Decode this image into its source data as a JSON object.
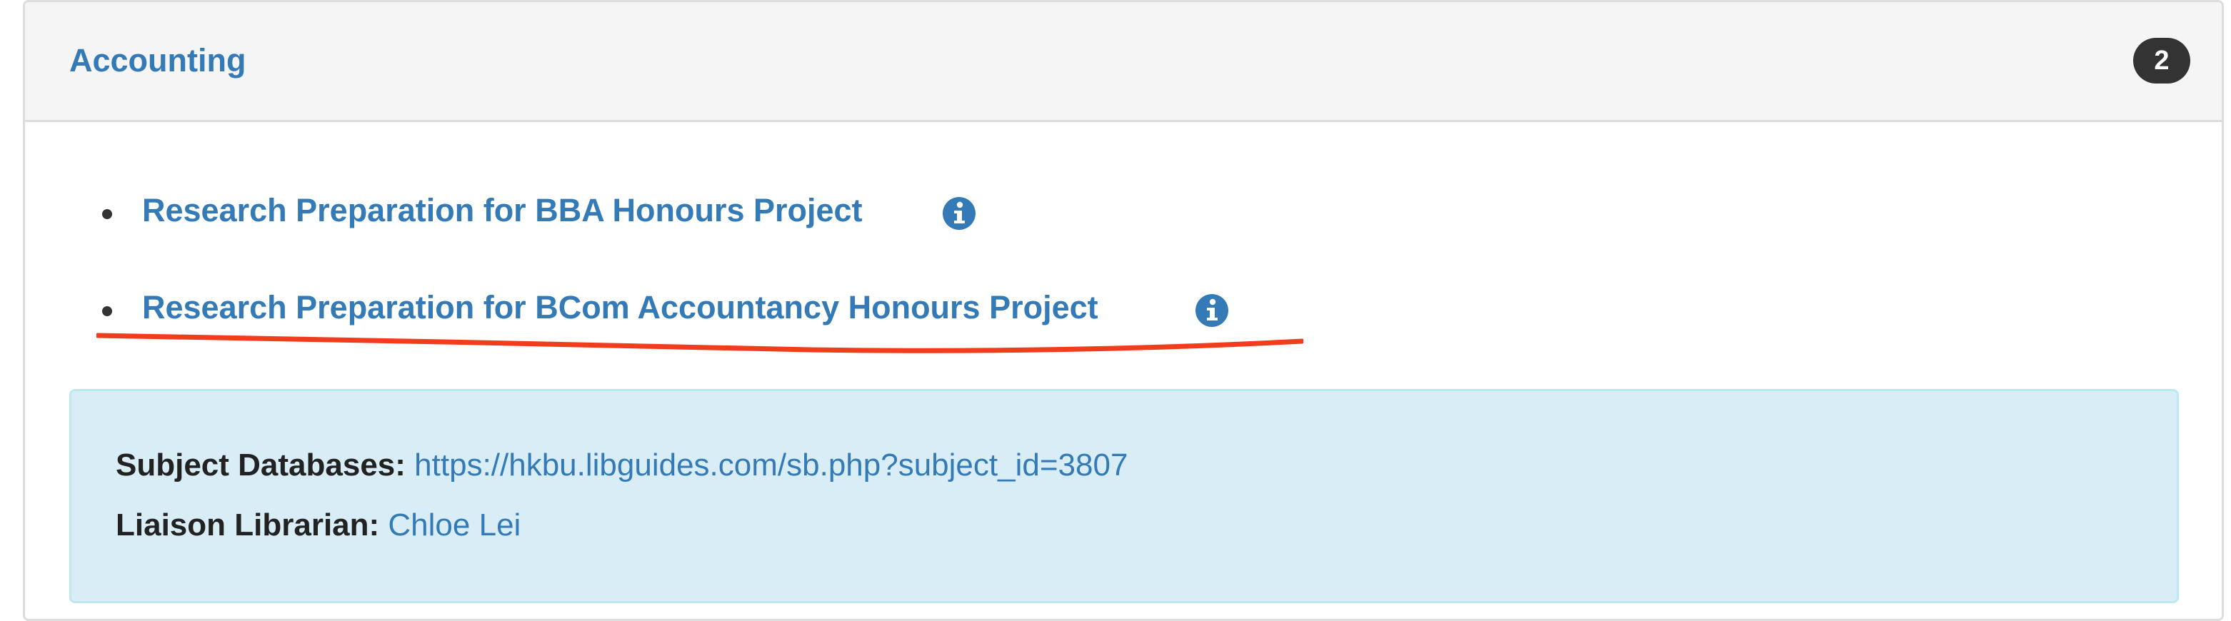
{
  "panel": {
    "title": "Accounting",
    "badge_count": "2"
  },
  "guides": [
    {
      "label": "Research Preparation for BBA Honours Project",
      "icon": "info-circle-icon"
    },
    {
      "label": "Research Preparation for BCom Accountancy Honours Project",
      "icon": "info-circle-icon"
    }
  ],
  "annotation": {
    "underline_color": "#f23c1e"
  },
  "info_box": {
    "subject_databases_label": "Subject Databases:",
    "subject_databases_url": "https://hkbu.libguides.com/sb.php?subject_id=3807",
    "liaison_label": "Liaison Librarian:",
    "liaison_name": "Chloe Lei"
  },
  "colors": {
    "link": "#337ab7",
    "badge_bg": "#333333",
    "info_bg": "#d9edf7",
    "info_border": "#bce8f1"
  }
}
